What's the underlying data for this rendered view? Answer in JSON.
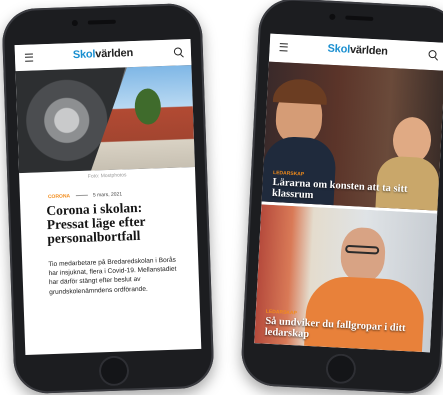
{
  "left_phone": {
    "logo_part1": "Skol",
    "logo_part2": "världen",
    "photo_caption": "Foto: Mostphotos",
    "category": "CORONA",
    "date": "5 mars, 2021",
    "headline": "Corona i skolan: Pressat läge efter personalbortfall",
    "body": "Tio medarbetare på Bredaredskolan i Borås har insjuknat, flera i Covid-19. Mellanstadiet har därför stängt efter beslut av grundskolenämndens ordförande."
  },
  "right_phone": {
    "logo_part1": "Skol",
    "logo_part2": "världen",
    "card1": {
      "tag": "LEDARSKAP",
      "headline": "Lärarna om konsten att ta sitt klassrum"
    },
    "card2": {
      "tag": "LEDARSKAP",
      "headline": "Så undviker du fallgropar i ditt ledarskap"
    }
  },
  "colors": {
    "brand_blue": "#1a8fd0",
    "accent_orange": "#f28c1b",
    "phone_body": "#1c1d20"
  }
}
